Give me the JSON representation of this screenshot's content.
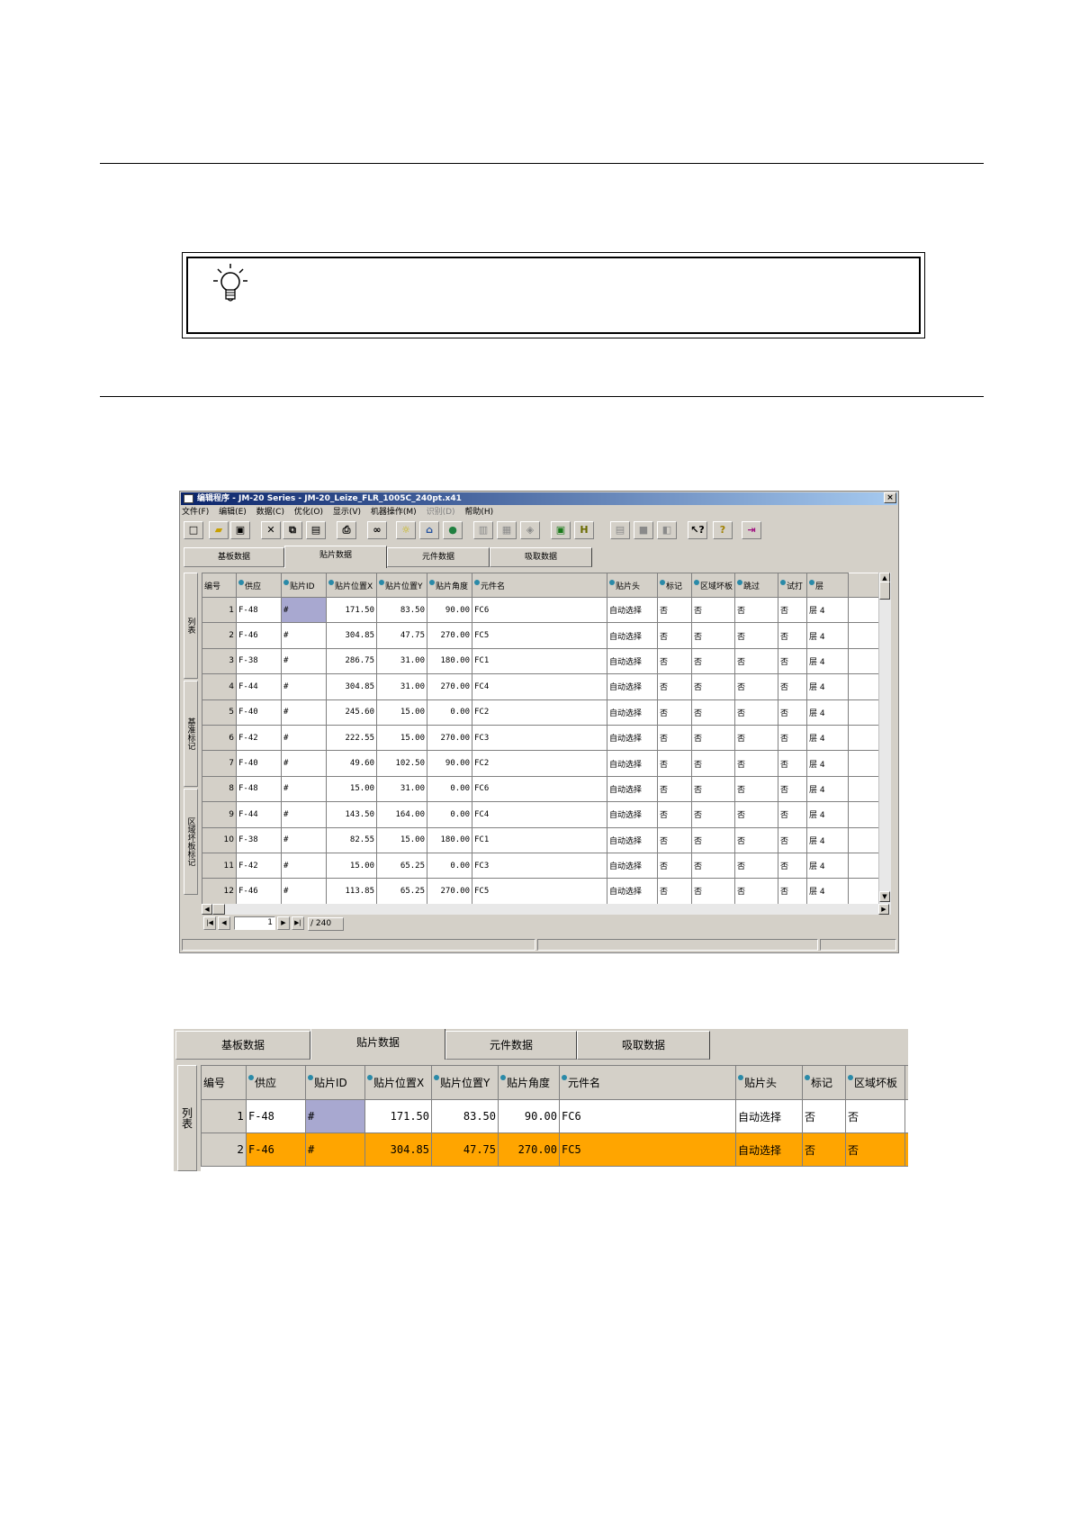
{
  "window": {
    "title": "编辑程序 - JM-20 Series - JM-20_Leize_FLR_1005C_240pt.x41",
    "close": "×",
    "menu": [
      "文件(F)",
      "编辑(E)",
      "数据(C)",
      "优化(O)",
      "显示(V)",
      "机器操作(M)",
      "识别(D)",
      "帮助(H)"
    ]
  },
  "toolbar_icons": [
    "new-icon",
    "open-icon",
    "save-icon",
    "delete-icon",
    "copy-icon",
    "paste-icon",
    "print-icon",
    "find-icon",
    "light-icon",
    "nozzle-icon",
    "colors-icon",
    "image-icon",
    "feeder-icon",
    "tray-icon",
    "fit-icon",
    "height-icon",
    "grid-icon",
    "square-icon",
    "layers-icon",
    "context-help-icon",
    "help-icon",
    "exit-icon"
  ],
  "tabs": [
    "基板数据",
    "贴片数据",
    "元件数据",
    "吸取数据"
  ],
  "active_tab": 1,
  "side_tabs": [
    "列表",
    "基准标记",
    "区域坏板标记"
  ],
  "columns": [
    "编号",
    "供应",
    "贴片ID",
    "贴片位置X",
    "贴片位置Y",
    "贴片角度",
    "元件名",
    "贴片头",
    "标记",
    "区域坏板",
    "跳过",
    "试打",
    "层"
  ],
  "rows": [
    {
      "no": "1",
      "feeder": "F-48",
      "id": "#",
      "x": "171.50",
      "y": "83.50",
      "angle": "90.00",
      "part": "FC6",
      "head": "自动选择",
      "mark": "否",
      "bad": "否",
      "skip": "否",
      "trial": "否",
      "layer": "层 4"
    },
    {
      "no": "2",
      "feeder": "F-46",
      "id": "#",
      "x": "304.85",
      "y": "47.75",
      "angle": "270.00",
      "part": "FC5",
      "head": "自动选择",
      "mark": "否",
      "bad": "否",
      "skip": "否",
      "trial": "否",
      "layer": "层 4"
    },
    {
      "no": "3",
      "feeder": "F-38",
      "id": "#",
      "x": "286.75",
      "y": "31.00",
      "angle": "180.00",
      "part": "FC1",
      "head": "自动选择",
      "mark": "否",
      "bad": "否",
      "skip": "否",
      "trial": "否",
      "layer": "层 4"
    },
    {
      "no": "4",
      "feeder": "F-44",
      "id": "#",
      "x": "304.85",
      "y": "31.00",
      "angle": "270.00",
      "part": "FC4",
      "head": "自动选择",
      "mark": "否",
      "bad": "否",
      "skip": "否",
      "trial": "否",
      "layer": "层 4"
    },
    {
      "no": "5",
      "feeder": "F-40",
      "id": "#",
      "x": "245.60",
      "y": "15.00",
      "angle": "0.00",
      "part": "FC2",
      "head": "自动选择",
      "mark": "否",
      "bad": "否",
      "skip": "否",
      "trial": "否",
      "layer": "层 4"
    },
    {
      "no": "6",
      "feeder": "F-42",
      "id": "#",
      "x": "222.55",
      "y": "15.00",
      "angle": "270.00",
      "part": "FC3",
      "head": "自动选择",
      "mark": "否",
      "bad": "否",
      "skip": "否",
      "trial": "否",
      "layer": "层 4"
    },
    {
      "no": "7",
      "feeder": "F-40",
      "id": "#",
      "x": "49.60",
      "y": "102.50",
      "angle": "90.00",
      "part": "FC2",
      "head": "自动选择",
      "mark": "否",
      "bad": "否",
      "skip": "否",
      "trial": "否",
      "layer": "层 4"
    },
    {
      "no": "8",
      "feeder": "F-48",
      "id": "#",
      "x": "15.00",
      "y": "31.00",
      "angle": "0.00",
      "part": "FC6",
      "head": "自动选择",
      "mark": "否",
      "bad": "否",
      "skip": "否",
      "trial": "否",
      "layer": "层 4"
    },
    {
      "no": "9",
      "feeder": "F-44",
      "id": "#",
      "x": "143.50",
      "y": "164.00",
      "angle": "0.00",
      "part": "FC4",
      "head": "自动选择",
      "mark": "否",
      "bad": "否",
      "skip": "否",
      "trial": "否",
      "layer": "层 4"
    },
    {
      "no": "10",
      "feeder": "F-38",
      "id": "#",
      "x": "82.55",
      "y": "15.00",
      "angle": "180.00",
      "part": "FC1",
      "head": "自动选择",
      "mark": "否",
      "bad": "否",
      "skip": "否",
      "trial": "否",
      "layer": "层 4"
    },
    {
      "no": "11",
      "feeder": "F-42",
      "id": "#",
      "x": "15.00",
      "y": "65.25",
      "angle": "0.00",
      "part": "FC3",
      "head": "自动选择",
      "mark": "否",
      "bad": "否",
      "skip": "否",
      "trial": "否",
      "layer": "层 4"
    },
    {
      "no": "12",
      "feeder": "F-46",
      "id": "#",
      "x": "113.85",
      "y": "65.25",
      "angle": "270.00",
      "part": "FC5",
      "head": "自动选择",
      "mark": "否",
      "bad": "否",
      "skip": "否",
      "trial": "否",
      "layer": "层 4"
    }
  ],
  "pager": {
    "page": "1",
    "total": "/ 240"
  },
  "zoom_view": {
    "tabs": [
      "基板数据",
      "贴片数据",
      "元件数据",
      "吸取数据"
    ],
    "side_tab": "列表",
    "columns": [
      "编号",
      "供应",
      "贴片ID",
      "贴片位置X",
      "贴片位置Y",
      "贴片角度",
      "元件名",
      "贴片头",
      "标记",
      "区域坏板"
    ],
    "rows": [
      {
        "no": "1",
        "feeder": "F-48",
        "id": "#",
        "x": "171.50",
        "y": "83.50",
        "angle": "90.00",
        "part": "FC6",
        "head": "自动选择",
        "mark": "否",
        "bad": "否"
      },
      {
        "no": "2",
        "feeder": "F-46",
        "id": "#",
        "x": "304.85",
        "y": "47.75",
        "angle": "270.00",
        "part": "FC5",
        "head": "自动选择",
        "mark": "否",
        "bad": "否"
      }
    ],
    "highlight_color": "#ffa500"
  }
}
